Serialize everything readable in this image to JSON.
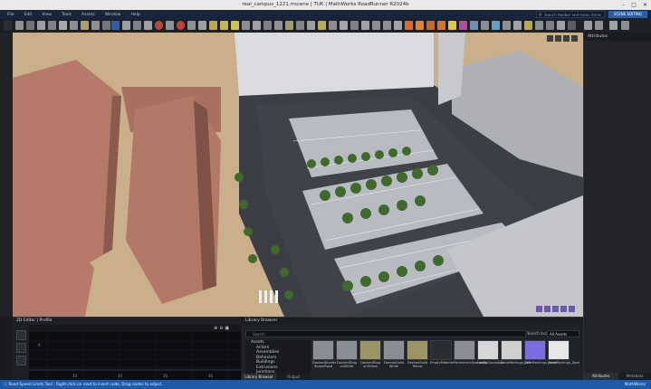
{
  "window": {
    "title": "real_campus_1221.rrscene | TUK | MathWorks RoadRunner R2024b"
  },
  "menu": {
    "items": [
      "File",
      "Edit",
      "View",
      "Tools",
      "Assets",
      "Window",
      "Help"
    ]
  },
  "search": {
    "placeholder": "Search toolbar and menu items (Ctrl..."
  },
  "scene_editing_label": "SCENE EDITING",
  "attributes_panel": {
    "title": "Attributes",
    "tabs": [
      "Attributes",
      "Metadata"
    ]
  },
  "sd_editor": {
    "title": "2D Editor | Profile",
    "ticks": [
      "10",
      "20",
      "30",
      "40"
    ],
    "y_tick": "0"
  },
  "library": {
    "title": "Library Browser",
    "search_placeholder": "Search",
    "sort_label": "Search location",
    "sort_value": "All Assets",
    "tree": [
      {
        "label": "Assets",
        "root": true
      },
      {
        "label": "Actors"
      },
      {
        "label": "Assemblies"
      },
      {
        "label": "Behaviors"
      },
      {
        "label": "Buildings"
      },
      {
        "label": "Extrusions"
      },
      {
        "label": "Junctions"
      }
    ],
    "assets": [
      {
        "label": "DashedDivider\nShapeRoad",
        "color": "#8a8f95"
      },
      {
        "label": "DashedDiag\nonWhite",
        "color": "#8a8f95"
      },
      {
        "label": "DashedDiag\nonYellow",
        "color": "#9b9566"
      },
      {
        "label": "DashedSolid\nWhite",
        "color": "#8a8f95"
      },
      {
        "label": "DashedSolid\nYellow",
        "color": "#9b9566"
      },
      {
        "label": "EmptyMaterial",
        "color": "#2a2d31"
      },
      {
        "label": "ParametricDashedSp...",
        "color": "#8a8f95"
      },
      {
        "label": "LaddeCrosswalk",
        "color": "#d7d7d7"
      },
      {
        "label": "LaneMarkings_Diff",
        "color": "#cfcfcf"
      },
      {
        "label": "LaneMarkings_Norm",
        "color": "#7b6ce0"
      },
      {
        "label": "LaneMarkings_Spec",
        "color": "#e7e7e7"
      }
    ],
    "tabs": [
      "Library Browser",
      "Output"
    ]
  },
  "status": {
    "text": "Road Speed Limits Tool : Right-click on road to insert node, Drag nodes to adjust."
  },
  "brand": {
    "text": "MathWorks"
  },
  "colors": {
    "menubar": "#17243a",
    "accent": "#2b5ea8",
    "status": "#1e5aa8"
  }
}
